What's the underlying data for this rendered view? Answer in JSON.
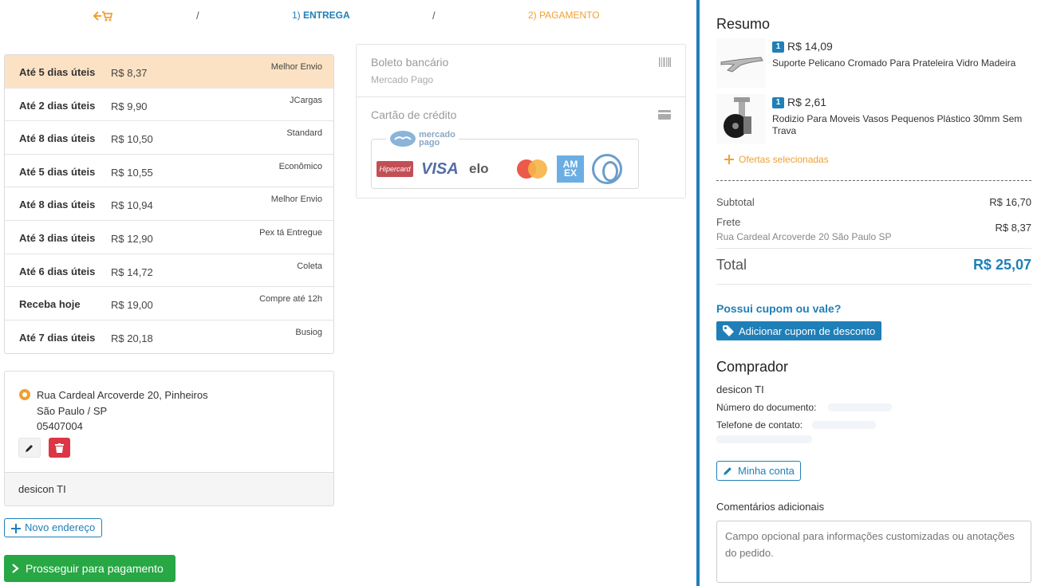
{
  "steps": {
    "sep": "/",
    "entrega_num": "1)",
    "entrega_label": "ENTREGA",
    "pagamento_num": "2)",
    "pagamento_label": "PAGAMENTO"
  },
  "shipping_options": [
    {
      "days": "Até 5 dias úteis",
      "price": "R$ 8,37",
      "carrier": "Melhor Envio",
      "selected": true
    },
    {
      "days": "Até 2 dias úteis",
      "price": "R$ 9,90",
      "carrier": "JCargas"
    },
    {
      "days": "Até 8 dias úteis",
      "price": "R$ 10,50",
      "carrier": "Standard"
    },
    {
      "days": "Até 5 dias úteis",
      "price": "R$ 10,55",
      "carrier": "Econômico"
    },
    {
      "days": "Até 8 dias úteis",
      "price": "R$ 10,94",
      "carrier": "Melhor Envio"
    },
    {
      "days": "Até 3 dias úteis",
      "price": "R$ 12,90",
      "carrier": "Pex tá Entregue"
    },
    {
      "days": "Até 6 dias úteis",
      "price": "R$ 14,72",
      "carrier": "Coleta"
    },
    {
      "days": "Receba hoje",
      "price": "R$ 19,00",
      "carrier": "Compre até 12h"
    },
    {
      "days": "Até 7 dias úteis",
      "price": "R$ 20,18",
      "carrier": "Busiog"
    }
  ],
  "address": {
    "line1": "Rua Cardeal Arcoverde 20, Pinheiros",
    "line2": "São Paulo / SP",
    "line3": "05407004",
    "recipient": "desicon TI"
  },
  "buttons": {
    "novo_endereco": "Novo endereço",
    "prosseguir": "Prosseguir para pagamento"
  },
  "payment": {
    "boleto_title": "Boleto bancário",
    "boleto_sub": "Mercado Pago",
    "cartao_title": "Cartão de crédito",
    "mp_logo_text_1": "mercado",
    "mp_logo_text_2": "pago",
    "brands": {
      "hipercard": "Hipercard",
      "visa": "VISA",
      "elo": "elo",
      "amex_1": "AM",
      "amex_2": "EX"
    }
  },
  "summary": {
    "title": "Resumo",
    "products": [
      {
        "qty": "1",
        "price": "R$ 14,09",
        "name": "Suporte Pelicano Cromado Para Prateleira Vidro Madeira"
      },
      {
        "qty": "1",
        "price": "R$ 2,61",
        "name": "Rodizio Para Moveis Vasos Pequenos Plástico 30mm Sem Trava"
      }
    ],
    "ofertas": "Ofertas selecionadas",
    "subtotal_label": "Subtotal",
    "subtotal_value": "R$ 16,70",
    "frete_label": "Frete",
    "frete_value": "R$ 8,37",
    "frete_address": "Rua Cardeal Arcoverde 20 São Paulo SP",
    "total_label": "Total",
    "total_value": "R$ 25,07",
    "cupom_question": "Possui cupom ou vale?",
    "cupom_button": "Adicionar cupom de desconto"
  },
  "buyer": {
    "title": "Comprador",
    "name": "desicon TI",
    "documento_label": "Número do documento:",
    "telefone_label": "Telefone de contato:",
    "minha_conta": "Minha conta",
    "comentarios_label": "Comentários adicionais",
    "comentarios_placeholder": "Campo opcional para informações customizadas ou anotações do pedido."
  },
  "colors": {
    "primary": "#1f7fb8",
    "accent_orange": "#f0a030",
    "success": "#28a745",
    "danger": "#dc3545",
    "selected_row": "#fce2c4"
  }
}
